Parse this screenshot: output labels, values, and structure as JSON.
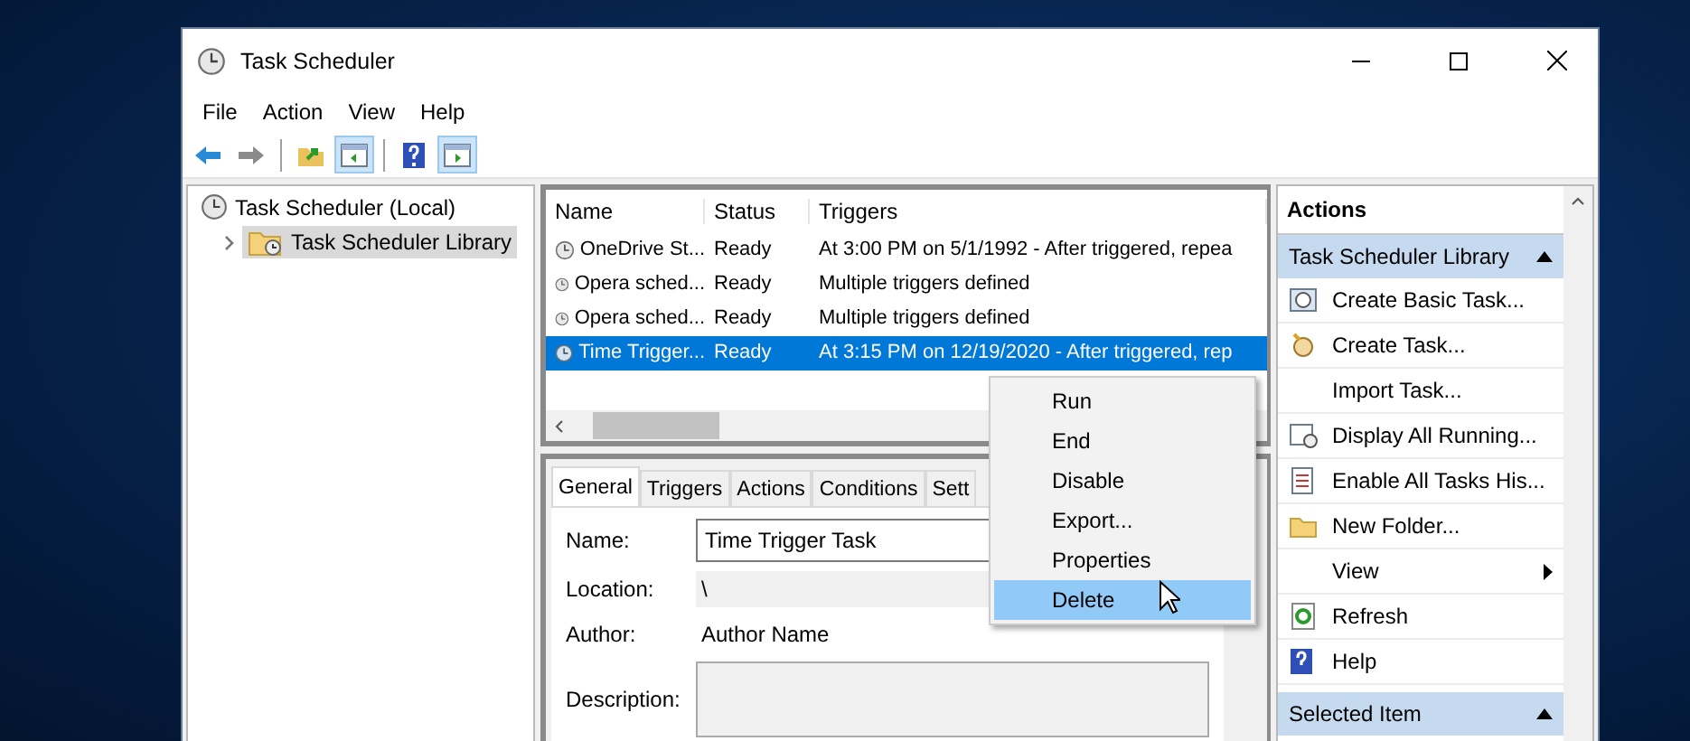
{
  "window": {
    "title": "Task Scheduler"
  },
  "menu": [
    "File",
    "Action",
    "View",
    "Help"
  ],
  "toolbar": [
    {
      "pressed": false
    },
    {
      "pressed": false
    },
    {
      "pressed": false
    },
    {
      "pressed": true
    },
    {
      "pressed": false
    },
    {
      "pressed": true
    }
  ],
  "tree": [
    {
      "label": "Task Scheduler (Local)",
      "selected": false,
      "children": [
        {
          "label": "Task Scheduler Library",
          "selected": true,
          "expanded": false
        }
      ]
    }
  ],
  "task_list": {
    "columns": [
      "Name",
      "Status",
      "Triggers"
    ],
    "rows": [
      {
        "name": "OneDrive St...",
        "status": "Ready",
        "triggers": "At 3:00 PM on 5/1/1992 - After triggered, repea",
        "selected": false
      },
      {
        "name": "Opera sched...",
        "status": "Ready",
        "triggers": "Multiple triggers defined",
        "selected": false
      },
      {
        "name": "Opera sched...",
        "status": "Ready",
        "triggers": "Multiple triggers defined",
        "selected": false
      },
      {
        "name": "Time Trigger...",
        "status": "Ready",
        "triggers": "At 3:15 PM on 12/19/2020 - After triggered, rep",
        "selected": true
      }
    ]
  },
  "context_menu": [
    {
      "label": "Run",
      "selected": false
    },
    {
      "label": "End",
      "selected": false
    },
    {
      "label": "Disable",
      "selected": false
    },
    {
      "label": "Export...",
      "selected": false
    },
    {
      "label": "Properties",
      "selected": false
    },
    {
      "label": "Delete",
      "selected": true
    }
  ],
  "details": {
    "tabs": [
      {
        "label": "General",
        "selected": true
      },
      {
        "label": "Triggers",
        "selected": false
      },
      {
        "label": "Actions",
        "selected": false
      },
      {
        "label": "Conditions",
        "selected": false
      },
      {
        "label": "Sett",
        "selected": false
      }
    ],
    "fields": [
      {
        "label": "Name:",
        "value": "Time Trigger Task",
        "kind": "input"
      },
      {
        "label": "Location:",
        "value": "\\",
        "kind": "readonly"
      },
      {
        "label": "Author:",
        "value": "Author Name",
        "kind": "text"
      },
      {
        "label": "Description:",
        "kind": "textarea"
      }
    ]
  },
  "actions": {
    "title": "Actions",
    "sections": [
      {
        "title": "Task Scheduler Library",
        "expanded": true,
        "items": [
          {
            "label": "Create Basic Task...",
            "kind": "item"
          },
          {
            "label": "Create Task...",
            "kind": "item"
          },
          {
            "label": "Import Task...",
            "kind": "item"
          },
          {
            "label": "Display All Running...",
            "kind": "item"
          },
          {
            "label": "Enable All Tasks His...",
            "kind": "item"
          },
          {
            "label": "New Folder...",
            "kind": "item"
          },
          {
            "label": "View",
            "kind": "submenu"
          },
          {
            "label": "Refresh",
            "kind": "item"
          },
          {
            "label": "Help",
            "kind": "item"
          }
        ]
      },
      {
        "title": "Selected Item",
        "expanded": true
      }
    ]
  }
}
